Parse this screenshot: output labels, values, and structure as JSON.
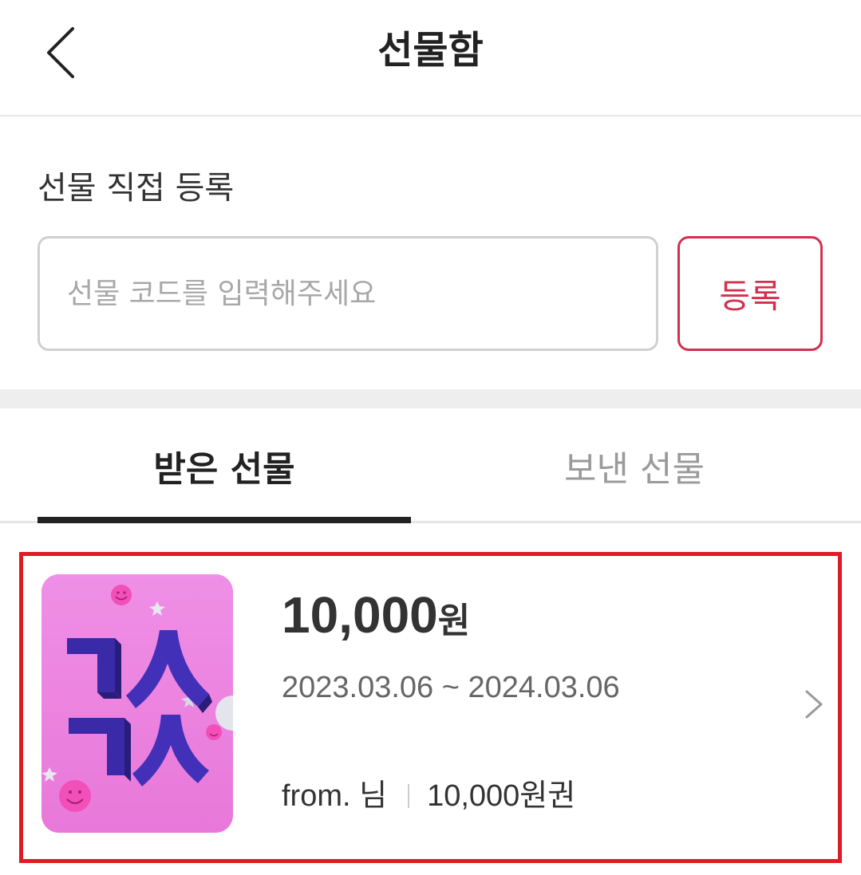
{
  "header": {
    "title": "선물함",
    "back_icon": "chevron-left-icon"
  },
  "register": {
    "section_title": "선물 직접 등록",
    "input_placeholder": "선물 코드를 입력해주세요",
    "input_value": "",
    "button_label": "등록",
    "accent_color": "#d3304e"
  },
  "tabs": [
    {
      "label": "받은 선물",
      "active": true
    },
    {
      "label": "보낸 선물",
      "active": false
    }
  ],
  "gift_item": {
    "amount": "10,000",
    "amount_unit": "원",
    "period": "2023.03.06 ~ 2024.03.06",
    "from": "from. 님",
    "voucher": "10,000원권",
    "thumbnail_art": "pink gift card with purple 3D Korean lettering",
    "chevron_icon": "chevron-right-icon",
    "highlight_color": "#e01b24"
  }
}
